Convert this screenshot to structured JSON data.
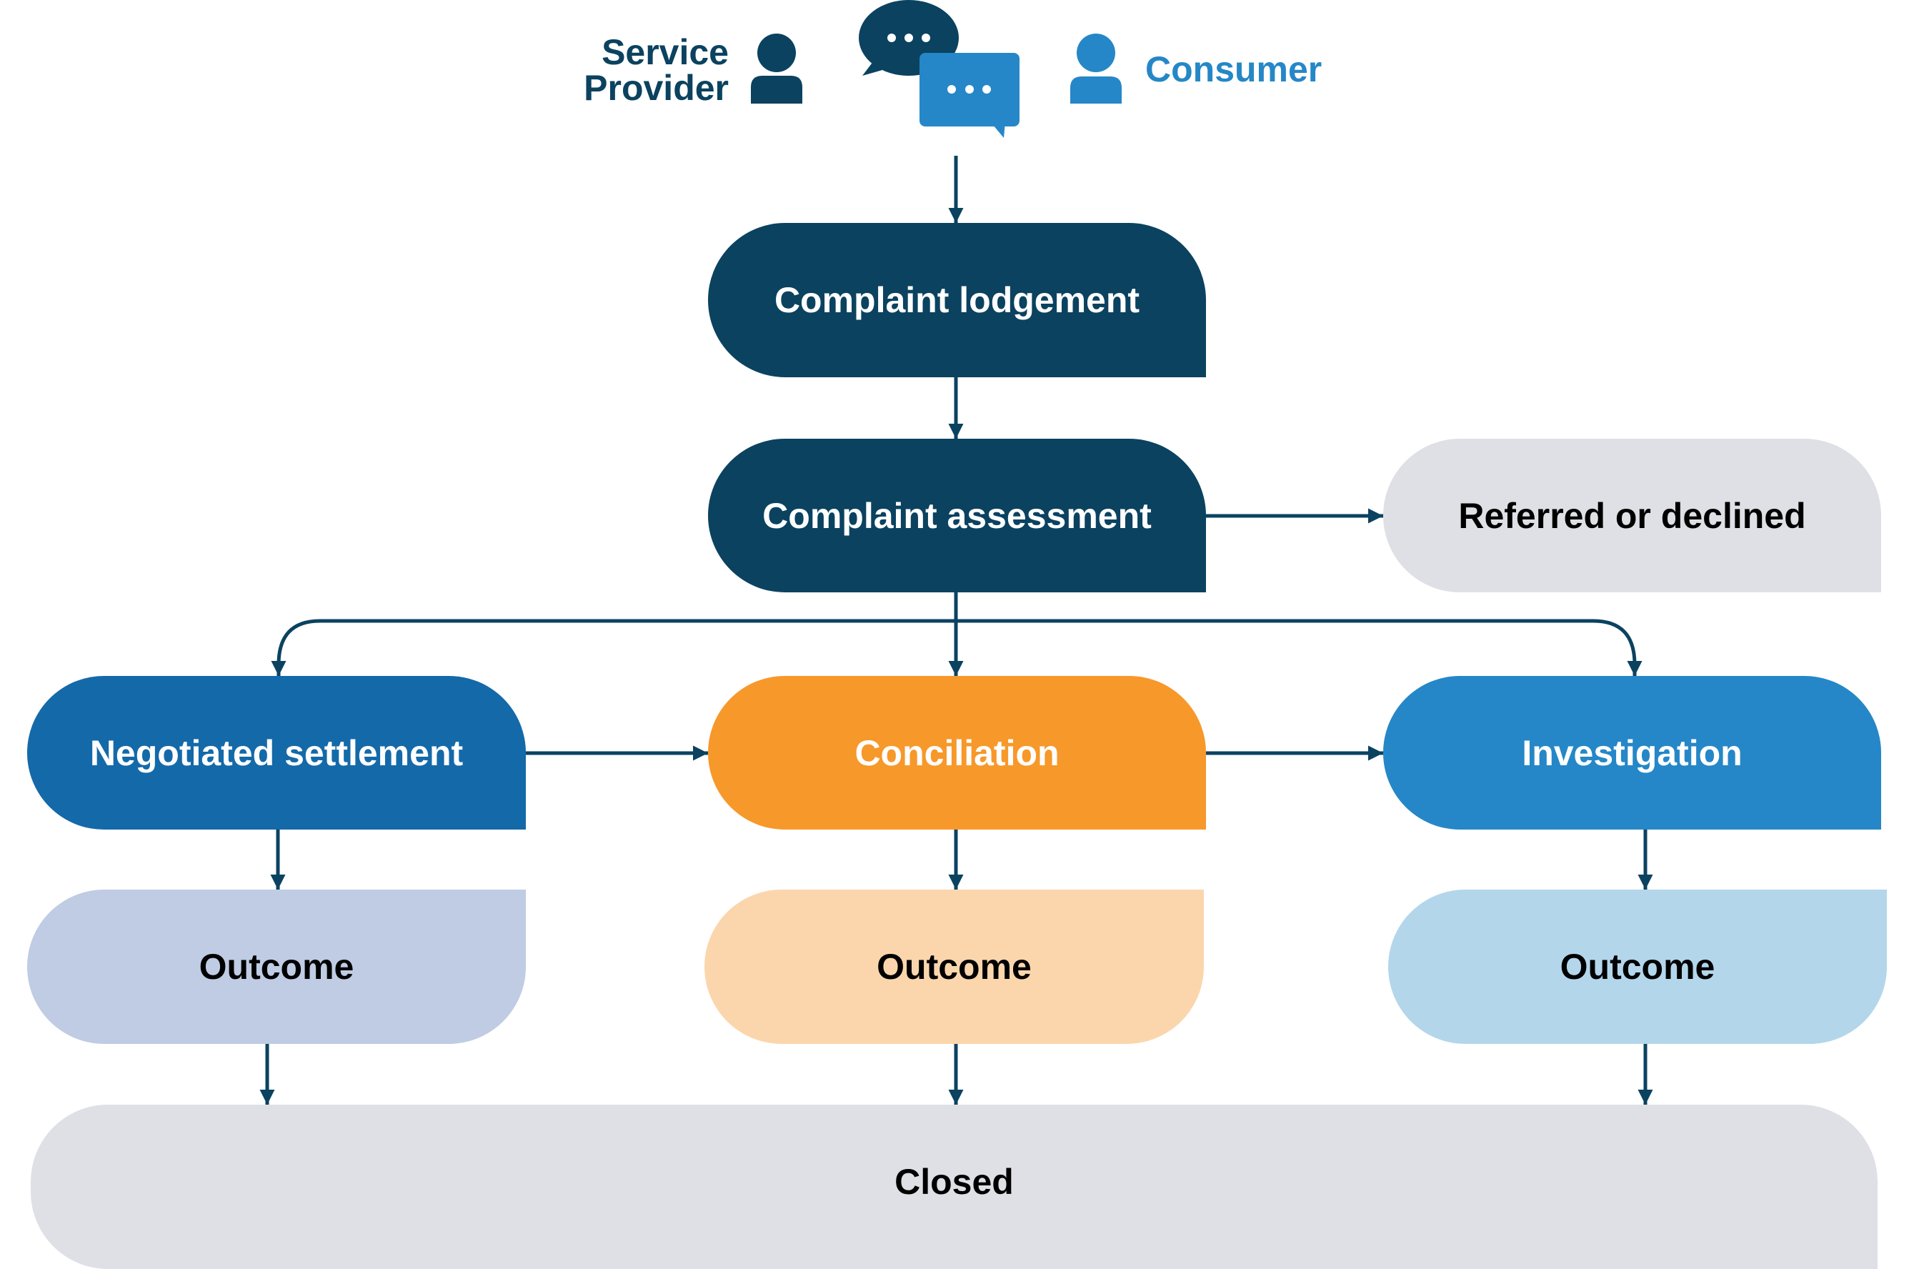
{
  "header": {
    "service_provider_line1": "Service",
    "service_provider_line2": "Provider",
    "consumer": "Consumer",
    "icons": [
      "person-icon",
      "speech-bubbles-icon",
      "person-icon"
    ]
  },
  "nodes": {
    "lodgement": "Complaint lodgement",
    "assessment": "Complaint assessment",
    "referred": "Referred or declined",
    "negotiated": "Negotiated settlement",
    "conciliation": "Conciliation",
    "investigation": "Investigation",
    "outcome_negotiated": "Outcome",
    "outcome_conciliation": "Outcome",
    "outcome_investigation": "Outcome",
    "closed": "Closed"
  },
  "edges": [
    {
      "from": "parties",
      "to": "lodgement"
    },
    {
      "from": "lodgement",
      "to": "assessment"
    },
    {
      "from": "assessment",
      "to": "referred"
    },
    {
      "from": "assessment",
      "to": "negotiated"
    },
    {
      "from": "assessment",
      "to": "conciliation"
    },
    {
      "from": "assessment",
      "to": "investigation"
    },
    {
      "from": "negotiated",
      "to": "conciliation"
    },
    {
      "from": "conciliation",
      "to": "investigation"
    },
    {
      "from": "negotiated",
      "to": "outcome_negotiated"
    },
    {
      "from": "conciliation",
      "to": "outcome_conciliation"
    },
    {
      "from": "investigation",
      "to": "outcome_investigation"
    },
    {
      "from": "outcome_negotiated",
      "to": "closed"
    },
    {
      "from": "outcome_conciliation",
      "to": "closed"
    },
    {
      "from": "outcome_investigation",
      "to": "closed"
    }
  ],
  "colors": {
    "dark_navy": "#0b4260",
    "negotiated_blue": "#1469a9",
    "conciliation_orange": "#f7982a",
    "investigation_blue": "#2587c7",
    "neutral_gray": "#dfe0e5",
    "outcome_negotiated": "#bfcce3",
    "outcome_conciliation": "#fbd6ad",
    "outcome_investigation": "#b3d6eb"
  }
}
